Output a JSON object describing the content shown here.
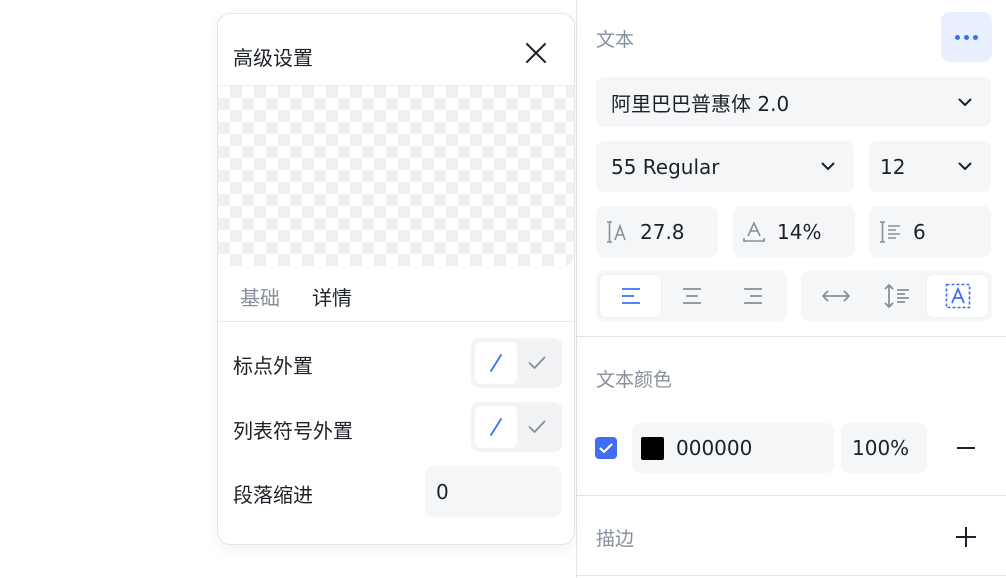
{
  "text_panel": {
    "title": "文本",
    "more_icon": "more-dots-icon",
    "font_family": "阿里巴巴普惠体 2.0",
    "font_weight": "55 Regular",
    "font_size": "12",
    "line_height": "27.8",
    "letter_spacing": "14%",
    "paragraph_spacing": "6",
    "align_options": [
      "align-left-icon",
      "align-center-icon",
      "align-right-icon"
    ],
    "resize_options": [
      "auto-width-icon",
      "auto-height-icon",
      "fixed-size-icon"
    ]
  },
  "fill_panel": {
    "title": "文本颜色",
    "checked": true,
    "hex": "000000",
    "opacity": "100%",
    "color": "#000000"
  },
  "stroke_panel": {
    "title": "描边"
  },
  "popup": {
    "title": "高级设置",
    "tabs": [
      "基础",
      "详情"
    ],
    "active_tab": "详情",
    "rows": {
      "punctuation": "标点外置",
      "list_marker": "列表符号外置",
      "indent": "段落缩进",
      "indent_value": "0"
    }
  },
  "colors": {
    "accent": "#3f6ef5",
    "accent_bg": "#e8efff",
    "field_bg": "#f5f6f8",
    "muted_text": "#86909c"
  }
}
